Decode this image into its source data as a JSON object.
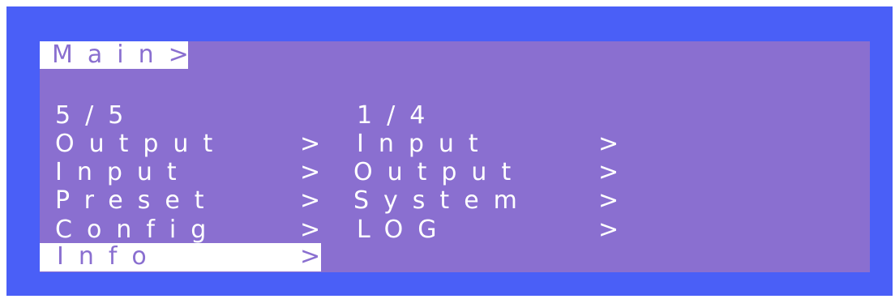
{
  "menu": {
    "title": "Main>",
    "left_page": "5/5",
    "right_page": "1/4",
    "arrow": ">",
    "left_items": [
      {
        "label": "Output"
      },
      {
        "label": "Input"
      },
      {
        "label": "Preset"
      },
      {
        "label": "Config"
      },
      {
        "label": "Info"
      }
    ],
    "right_items": [
      {
        "label": "Input"
      },
      {
        "label": "Output"
      },
      {
        "label": "System"
      },
      {
        "label": "LOG"
      }
    ],
    "selected_left_item": "Info"
  },
  "colors": {
    "frame": "#4a5ff7",
    "lcd_background": "#8a6fd0",
    "text": "#ffffff",
    "highlight": "#ffffff"
  }
}
